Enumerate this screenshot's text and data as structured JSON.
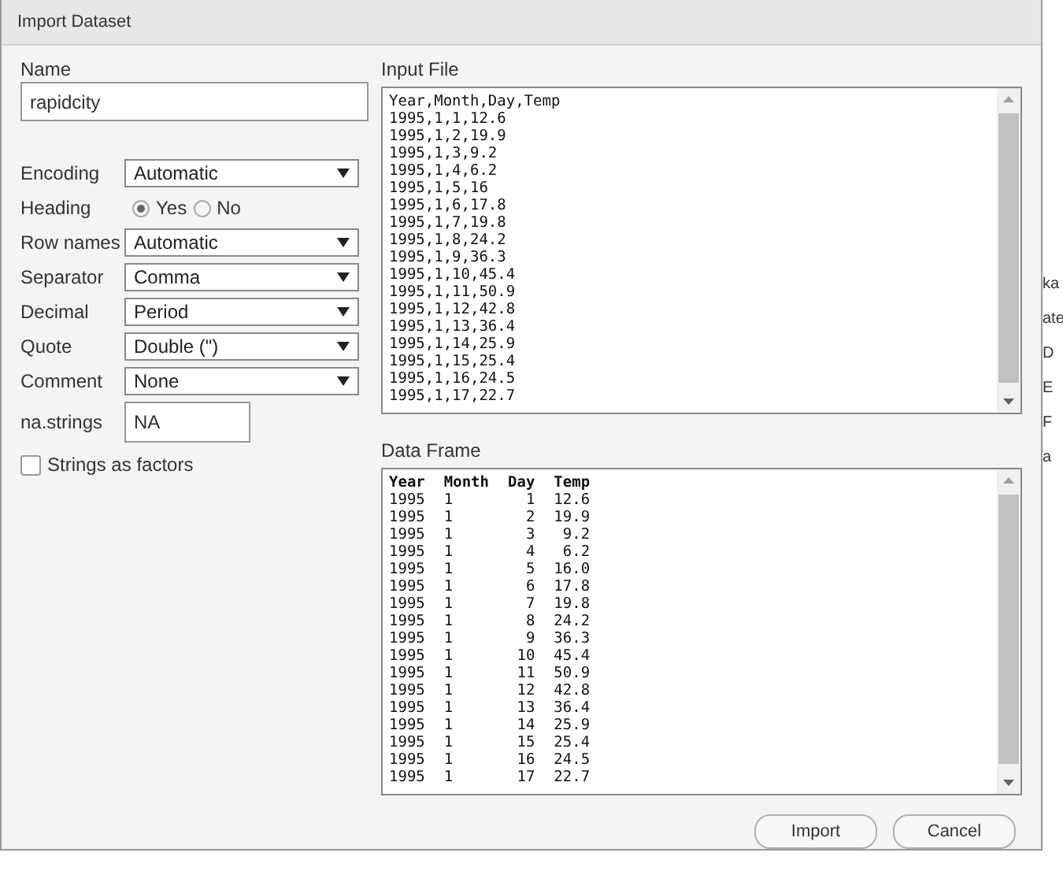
{
  "window": {
    "title": "Import Dataset"
  },
  "name_field": {
    "label": "Name",
    "value": "rapidcity"
  },
  "options": [
    {
      "kind": "select",
      "label": "Encoding",
      "value": "Automatic"
    },
    {
      "kind": "radio",
      "label": "Heading",
      "choices": [
        {
          "label": "Yes",
          "selected": true
        },
        {
          "label": "No",
          "selected": false
        }
      ]
    },
    {
      "kind": "select",
      "label": "Row names",
      "value": "Automatic"
    },
    {
      "kind": "select",
      "label": "Separator",
      "value": "Comma"
    },
    {
      "kind": "select",
      "label": "Decimal",
      "value": "Period"
    },
    {
      "kind": "select",
      "label": "Quote",
      "value": "Double (\")"
    },
    {
      "kind": "select",
      "label": "Comment",
      "value": "None"
    },
    {
      "kind": "text",
      "label": "na.strings",
      "value": "NA"
    }
  ],
  "strings_as_factors": {
    "label": "Strings as factors",
    "checked": false
  },
  "input_file": {
    "label": "Input File",
    "lines": [
      "Year,Month,Day,Temp",
      "1995,1,1,12.6",
      "1995,1,2,19.9",
      "1995,1,3,9.2",
      "1995,1,4,6.2",
      "1995,1,5,16",
      "1995,1,6,17.8",
      "1995,1,7,19.8",
      "1995,1,8,24.2",
      "1995,1,9,36.3",
      "1995,1,10,45.4",
      "1995,1,11,50.9",
      "1995,1,12,42.8",
      "1995,1,13,36.4",
      "1995,1,14,25.9",
      "1995,1,15,25.4",
      "1995,1,16,24.5",
      "1995,1,17,22.7"
    ]
  },
  "data_frame": {
    "label": "Data Frame",
    "columns": [
      "Year",
      "Month",
      "Day",
      "Temp"
    ],
    "rows": [
      [
        "1995",
        "1",
        "1",
        "12.6"
      ],
      [
        "1995",
        "1",
        "2",
        "19.9"
      ],
      [
        "1995",
        "1",
        "3",
        "9.2"
      ],
      [
        "1995",
        "1",
        "4",
        "6.2"
      ],
      [
        "1995",
        "1",
        "5",
        "16.0"
      ],
      [
        "1995",
        "1",
        "6",
        "17.8"
      ],
      [
        "1995",
        "1",
        "7",
        "19.8"
      ],
      [
        "1995",
        "1",
        "8",
        "24.2"
      ],
      [
        "1995",
        "1",
        "9",
        "36.3"
      ],
      [
        "1995",
        "1",
        "10",
        "45.4"
      ],
      [
        "1995",
        "1",
        "11",
        "50.9"
      ],
      [
        "1995",
        "1",
        "12",
        "42.8"
      ],
      [
        "1995",
        "1",
        "13",
        "36.4"
      ],
      [
        "1995",
        "1",
        "14",
        "25.9"
      ],
      [
        "1995",
        "1",
        "15",
        "25.4"
      ],
      [
        "1995",
        "1",
        "16",
        "24.5"
      ],
      [
        "1995",
        "1",
        "17",
        "22.7"
      ]
    ]
  },
  "buttons": [
    "Import",
    "Cancel"
  ],
  "background_fragments": [
    "ka",
    "ate",
    "D",
    "E",
    "F",
    "a"
  ]
}
